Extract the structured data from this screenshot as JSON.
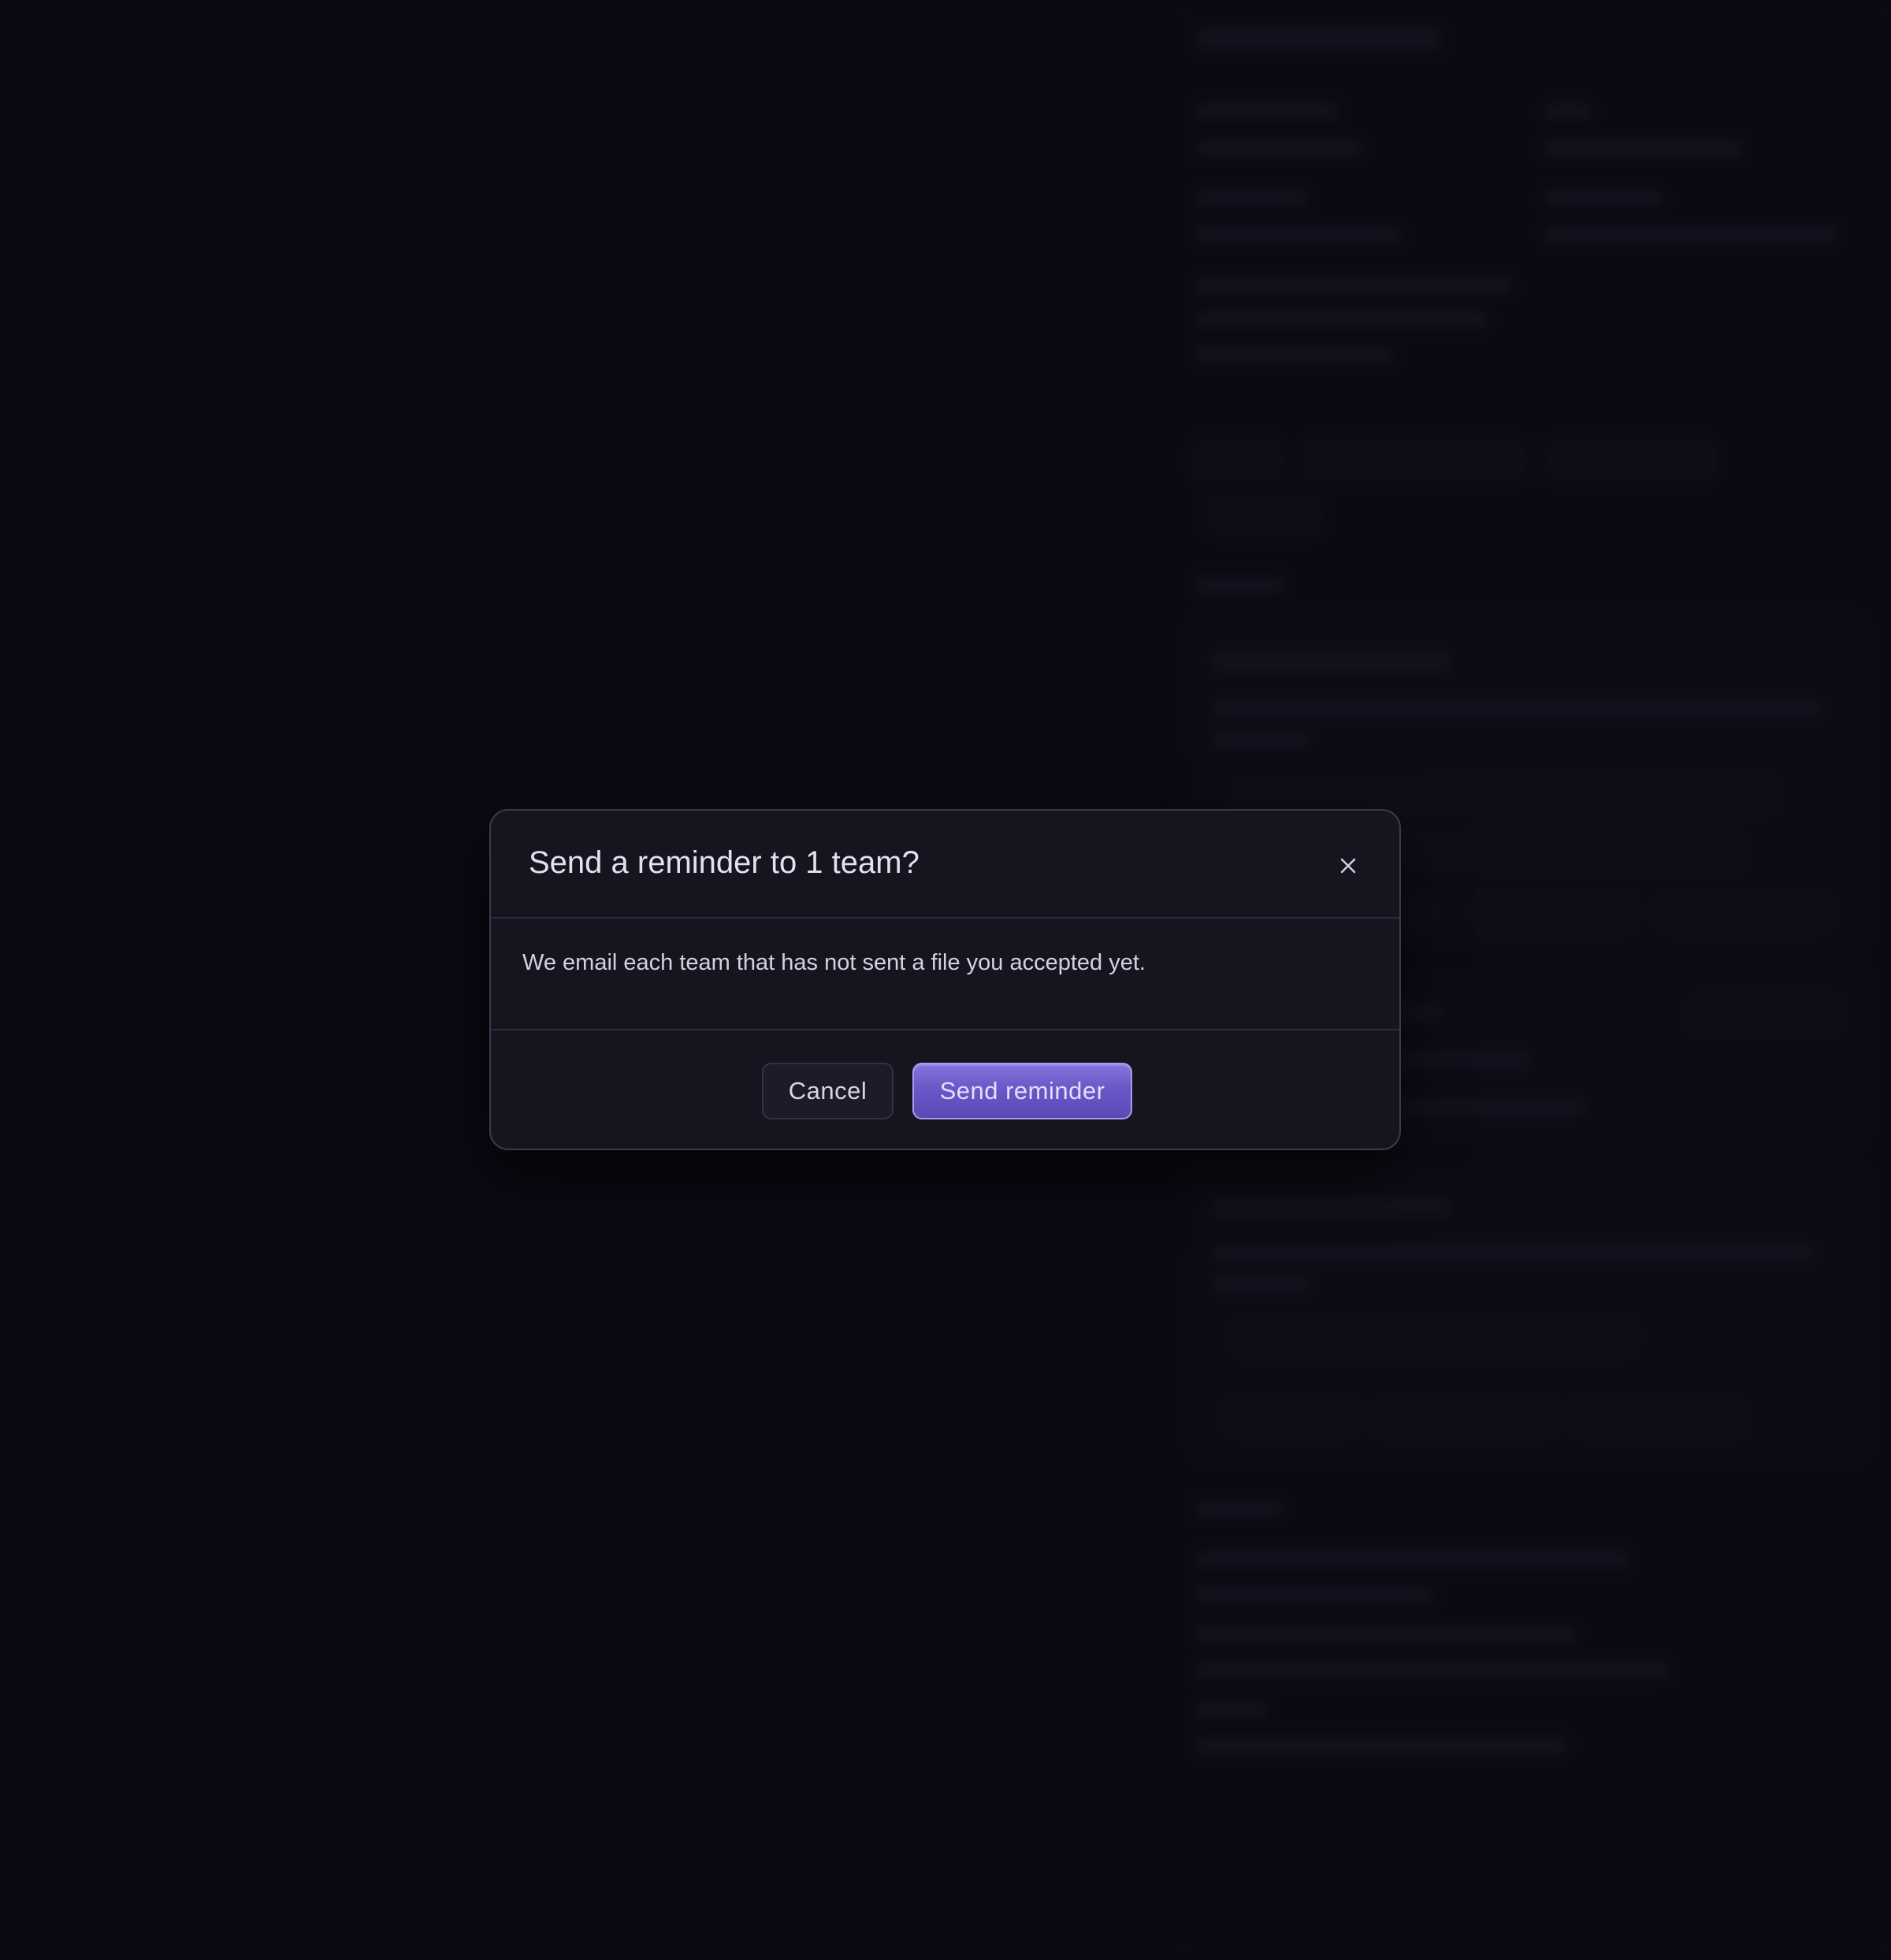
{
  "dialog": {
    "title": "Send a reminder to 1 team?",
    "message": "We email each team that has not sent a file you accepted yet.",
    "close_icon": "close-icon",
    "cancel_label": "Cancel",
    "confirm_label": "Send reminder"
  },
  "colors": {
    "backdrop": "#0d0c17",
    "dialog_background": "#15141f",
    "primary_accent": "#6a58c8"
  }
}
